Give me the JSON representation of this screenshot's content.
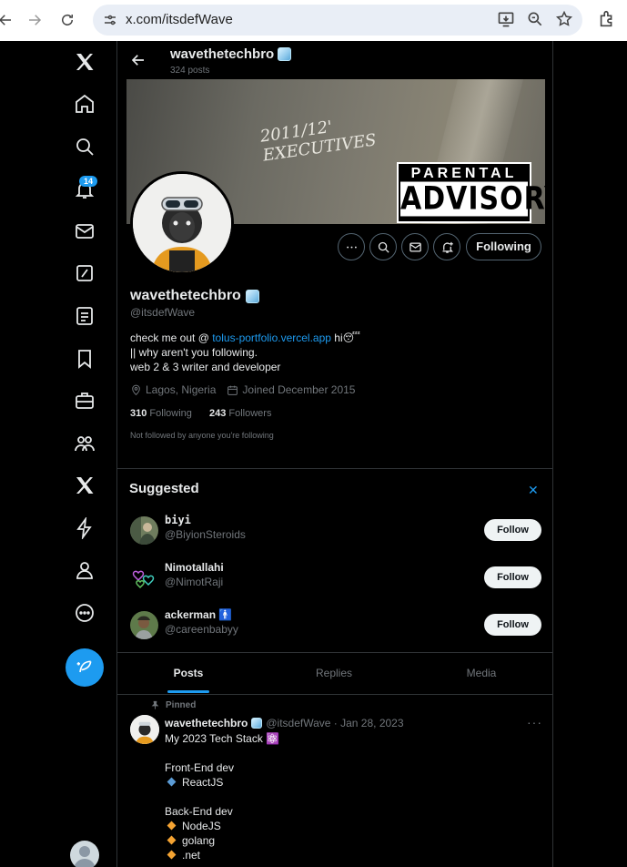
{
  "browser": {
    "url": "x.com/itsdefWave"
  },
  "nav": {
    "notification_badge": "14",
    "icons": [
      "x-logo-icon",
      "home-icon",
      "search-icon",
      "notifications-icon",
      "messages-icon",
      "grok-icon",
      "lists-icon",
      "bookmarks-icon",
      "jobs-icon",
      "communities-icon",
      "premium-icon",
      "verified-orgs-icon",
      "profile-icon",
      "more-icon"
    ]
  },
  "header": {
    "name": "wavethetechbro",
    "post_count": "324 posts"
  },
  "banner": {
    "scrawl_line1": "2011/12'",
    "scrawl_line2": "EXECUTIVES",
    "advisory_top": "PARENTAL",
    "advisory_bottom": "ADVISORY"
  },
  "profile": {
    "name": "wavethetechbro",
    "handle": "@itsdefWave",
    "bio_prefix": "check me out @ ",
    "bio_link": "tolus-portfolio.vercel.app",
    "bio_suffix": " hi😴",
    "bio_line2": "|| why aren't you following.",
    "bio_line3": "web 2 & 3 writer and developer",
    "location": "Lagos, Nigeria",
    "joined": "Joined December 2015",
    "following_count": "310",
    "following_label": "Following",
    "followers_count": "243",
    "followers_label": "Followers",
    "not_followed": "Not followed by anyone you're following",
    "following_button": "Following"
  },
  "suggested": {
    "title": "Suggested",
    "close": "✕",
    "follow_label": "Follow",
    "users": [
      {
        "name": "biyi",
        "handle": "@BiyionSteroids"
      },
      {
        "name": "Nimotallahi",
        "handle": "@NimotRaji"
      },
      {
        "name": "ackerman 🚹",
        "handle": "@careenbabyy"
      }
    ]
  },
  "tabs": [
    {
      "label": "Posts"
    },
    {
      "label": "Replies"
    },
    {
      "label": "Media"
    }
  ],
  "post": {
    "pinned_label": "Pinned",
    "author": "wavethetechbro",
    "handle_date": "@itsdefWave · Jan 28, 2023",
    "more": "···",
    "line1": "My 2023 Tech Stack ⚛️",
    "frontend_heading": "Front-End dev",
    "frontend_items": [
      "ReactJS"
    ],
    "backend_heading": "Back-End dev",
    "backend_items": [
      "NodeJS",
      "golang",
      ".net"
    ]
  },
  "colors": {
    "accent": "#1d9bf0",
    "background": "#000000",
    "text": "#e7e9ea",
    "muted": "#71767b",
    "border": "#2f3336",
    "diamond_blue": "#5b9bd5",
    "diamond_orange": "#f4a332"
  }
}
